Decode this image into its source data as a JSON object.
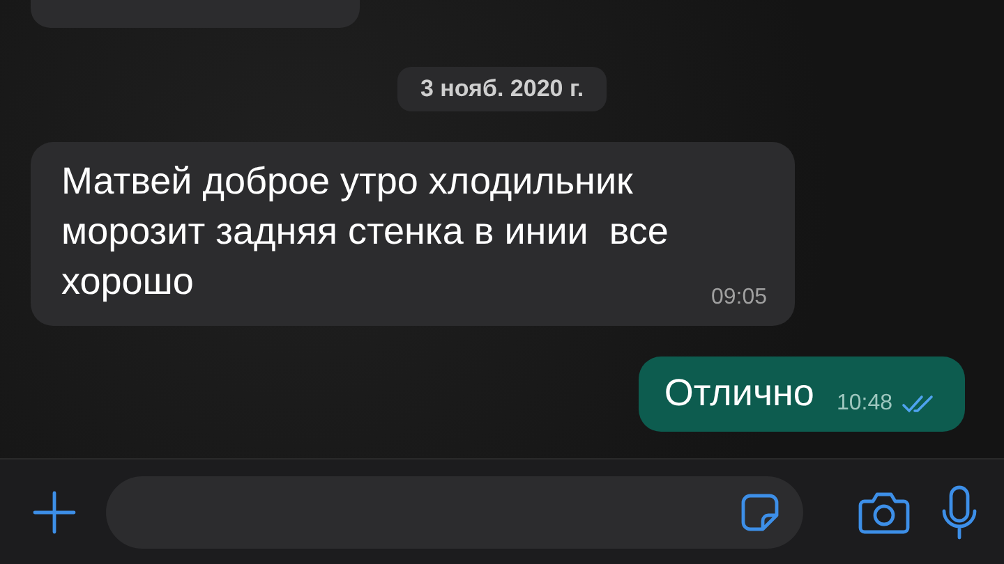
{
  "date_divider": "3 нояб. 2020 г.",
  "messages": [
    {
      "kind": "incoming",
      "text": "Матвей доброе утро хлодильник морозит задняя стенка в инии  все хорошо",
      "time": "09:05"
    },
    {
      "kind": "outgoing",
      "text": "Отлично",
      "time": "10:48",
      "read": true
    }
  ]
}
